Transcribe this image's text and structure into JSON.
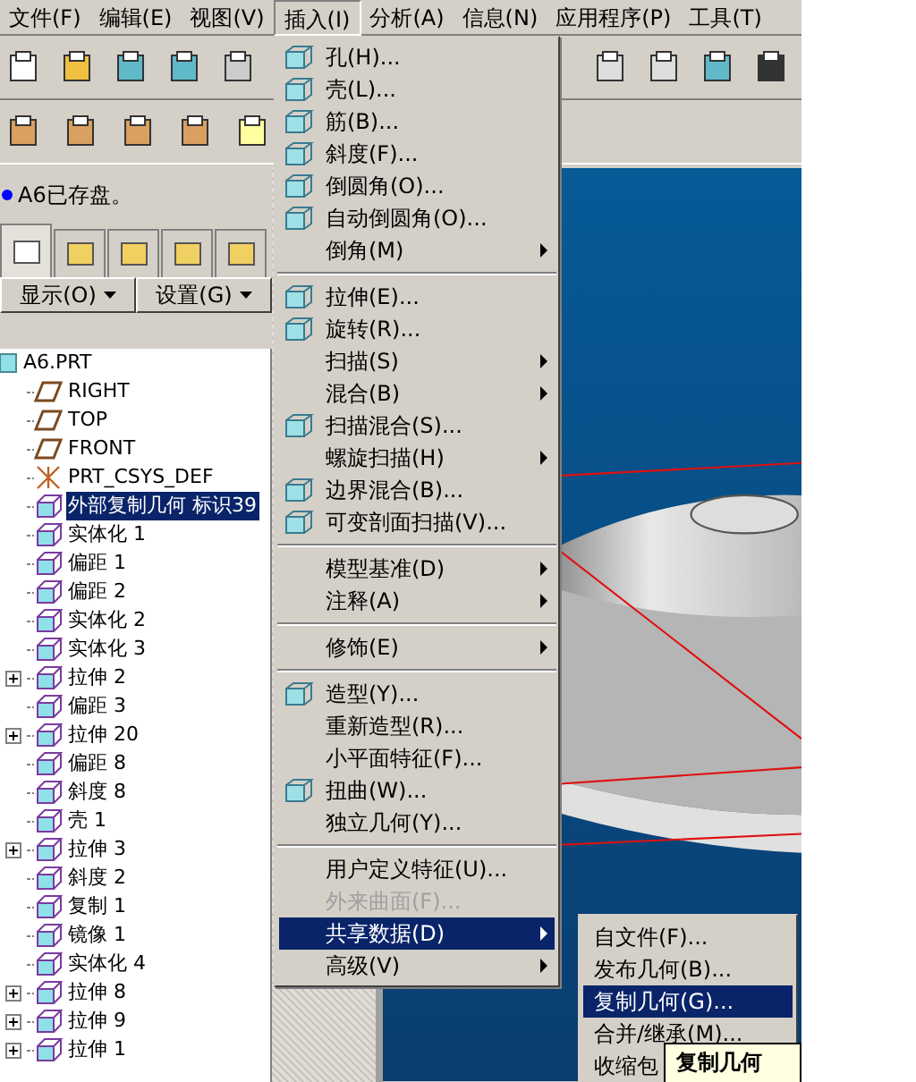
{
  "menu_bar": [
    {
      "label": "文件(F)",
      "selected": false
    },
    {
      "label": "编辑(E)",
      "selected": false
    },
    {
      "label": "视图(V)",
      "selected": false
    },
    {
      "label": "插入(I)",
      "selected": true
    },
    {
      "label": "分析(A)",
      "selected": false
    },
    {
      "label": "信息(N)",
      "selected": false
    },
    {
      "label": "应用程序(P)",
      "selected": false
    },
    {
      "label": "工具(T)",
      "selected": false
    }
  ],
  "message": "A6已存盘。",
  "navigator_tabs": [
    {
      "selected": true
    },
    {
      "selected": false
    },
    {
      "selected": false
    },
    {
      "selected": false
    },
    {
      "selected": false
    }
  ],
  "tree_buttons": [
    "显示(O)",
    "设置(G)"
  ],
  "model_tree": {
    "label": "A6.PRT",
    "selected": false,
    "children": [
      {
        "label": "RIGHT",
        "kind": "plane",
        "expandable": false,
        "selected": false
      },
      {
        "label": "TOP",
        "kind": "plane",
        "expandable": false,
        "selected": false
      },
      {
        "label": "FRONT",
        "kind": "plane",
        "expandable": false,
        "selected": false
      },
      {
        "label": "PRT_CSYS_DEF",
        "kind": "csys",
        "expandable": false,
        "selected": false
      },
      {
        "label": "外部复制几何 标识39",
        "kind": "feature",
        "expandable": false,
        "selected": true
      },
      {
        "label": "实体化 1",
        "kind": "feature",
        "expandable": false,
        "selected": false
      },
      {
        "label": "偏距 1",
        "kind": "feature",
        "expandable": false,
        "selected": false
      },
      {
        "label": "偏距 2",
        "kind": "feature",
        "expandable": false,
        "selected": false
      },
      {
        "label": "实体化 2",
        "kind": "feature",
        "expandable": false,
        "selected": false
      },
      {
        "label": "实体化 3",
        "kind": "feature",
        "expandable": false,
        "selected": false
      },
      {
        "label": "拉伸 2",
        "kind": "feature",
        "expandable": true,
        "selected": false
      },
      {
        "label": "偏距 3",
        "kind": "feature",
        "expandable": false,
        "selected": false
      },
      {
        "label": "拉伸 20",
        "kind": "feature",
        "expandable": true,
        "selected": false
      },
      {
        "label": "偏距 8",
        "kind": "feature",
        "expandable": false,
        "selected": false
      },
      {
        "label": "斜度 8",
        "kind": "feature",
        "expandable": false,
        "selected": false
      },
      {
        "label": "壳 1",
        "kind": "feature",
        "expandable": false,
        "selected": false
      },
      {
        "label": "拉伸 3",
        "kind": "feature",
        "expandable": true,
        "selected": false
      },
      {
        "label": "斜度 2",
        "kind": "feature",
        "expandable": false,
        "selected": false
      },
      {
        "label": "复制 1",
        "kind": "feature",
        "expandable": false,
        "selected": false
      },
      {
        "label": "镜像 1",
        "kind": "feature",
        "expandable": false,
        "selected": false
      },
      {
        "label": "实体化 4",
        "kind": "feature",
        "expandable": false,
        "selected": false
      },
      {
        "label": "拉伸 8",
        "kind": "feature",
        "expandable": true,
        "selected": false
      },
      {
        "label": "拉伸 9",
        "kind": "feature",
        "expandable": true,
        "selected": false
      },
      {
        "label": "拉伸 1",
        "kind": "feature",
        "expandable": true,
        "selected": false
      }
    ]
  },
  "insert_menu": [
    {
      "kind": "command",
      "label": "孔(H)...",
      "submenu": false,
      "disabled": false,
      "selected": false
    },
    {
      "kind": "command",
      "label": "壳(L)...",
      "submenu": false,
      "disabled": false,
      "selected": false
    },
    {
      "kind": "command",
      "label": "筋(B)...",
      "submenu": false,
      "disabled": false,
      "selected": false
    },
    {
      "kind": "command",
      "label": "斜度(F)...",
      "submenu": false,
      "disabled": false,
      "selected": false
    },
    {
      "kind": "command",
      "label": "倒圆角(O)...",
      "submenu": false,
      "disabled": false,
      "selected": false
    },
    {
      "kind": "command",
      "label": "自动倒圆角(O)...",
      "submenu": false,
      "disabled": false,
      "selected": false
    },
    {
      "kind": "plain",
      "label": "倒角(M)",
      "submenu": true,
      "disabled": false,
      "selected": false
    },
    {
      "kind": "separator"
    },
    {
      "kind": "command",
      "label": "拉伸(E)...",
      "submenu": false,
      "disabled": false,
      "selected": false
    },
    {
      "kind": "command",
      "label": "旋转(R)...",
      "submenu": false,
      "disabled": false,
      "selected": false
    },
    {
      "kind": "plain",
      "label": "扫描(S)",
      "submenu": true,
      "disabled": false,
      "selected": false
    },
    {
      "kind": "plain",
      "label": "混合(B)",
      "submenu": true,
      "disabled": false,
      "selected": false
    },
    {
      "kind": "command",
      "label": "扫描混合(S)...",
      "submenu": false,
      "disabled": false,
      "selected": false
    },
    {
      "kind": "plain",
      "label": "螺旋扫描(H)",
      "submenu": true,
      "disabled": false,
      "selected": false
    },
    {
      "kind": "command",
      "label": "边界混合(B)...",
      "submenu": false,
      "disabled": false,
      "selected": false
    },
    {
      "kind": "command",
      "label": "可变剖面扫描(V)...",
      "submenu": false,
      "disabled": false,
      "selected": false
    },
    {
      "kind": "separator"
    },
    {
      "kind": "plain",
      "label": "模型基准(D)",
      "submenu": true,
      "disabled": false,
      "selected": false
    },
    {
      "kind": "plain",
      "label": "注释(A)",
      "submenu": true,
      "disabled": false,
      "selected": false
    },
    {
      "kind": "separator"
    },
    {
      "kind": "plain",
      "label": "修饰(E)",
      "submenu": true,
      "disabled": false,
      "selected": false
    },
    {
      "kind": "separator"
    },
    {
      "kind": "command",
      "label": "造型(Y)...",
      "submenu": false,
      "disabled": false,
      "selected": false
    },
    {
      "kind": "plain",
      "label": "重新造型(R)...",
      "submenu": false,
      "disabled": false,
      "selected": false
    },
    {
      "kind": "plain",
      "label": "小平面特征(F)...",
      "submenu": false,
      "disabled": false,
      "selected": false
    },
    {
      "kind": "command",
      "label": "扭曲(W)...",
      "submenu": false,
      "disabled": false,
      "selected": false
    },
    {
      "kind": "plain",
      "label": "独立几何(Y)...",
      "submenu": false,
      "disabled": false,
      "selected": false
    },
    {
      "kind": "separator"
    },
    {
      "kind": "plain",
      "label": "用户定义特征(U)...",
      "submenu": false,
      "disabled": false,
      "selected": false
    },
    {
      "kind": "plain",
      "label": "外来曲面(F)...",
      "submenu": false,
      "disabled": true,
      "selected": false
    },
    {
      "kind": "plain",
      "label": "共享数据(D)",
      "submenu": true,
      "disabled": false,
      "selected": true
    },
    {
      "kind": "plain",
      "label": "高级(V)",
      "submenu": true,
      "disabled": false,
      "selected": false
    }
  ],
  "shared_data_submenu": [
    {
      "label": "自文件(F)...",
      "selected": false
    },
    {
      "label": "发布几何(B)...",
      "selected": false
    },
    {
      "label": "复制几何(G)...",
      "selected": true
    },
    {
      "label": "合并/继承(M)...",
      "selected": false
    },
    {
      "label": "收缩包",
      "selected": false
    }
  ],
  "tooltip": "复制几何"
}
